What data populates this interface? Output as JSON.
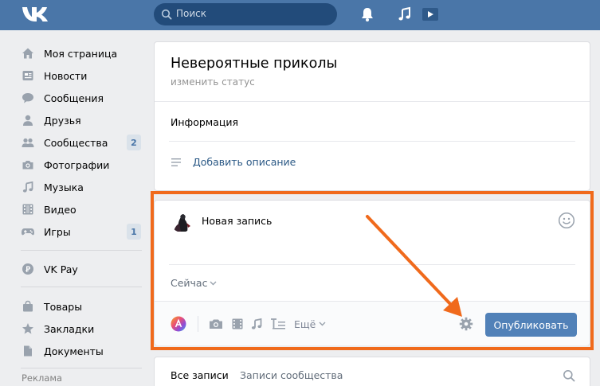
{
  "header": {
    "search_placeholder": "Поиск",
    "icons": [
      "vk-logo",
      "search-icon",
      "bell-icon",
      "music-icon",
      "play-icon"
    ],
    "bg_color": "#4a76a8"
  },
  "sidebar": {
    "items": [
      {
        "label": "Моя страница",
        "icon": "home-icon"
      },
      {
        "label": "Новости",
        "icon": "news-icon"
      },
      {
        "label": "Сообщения",
        "icon": "messages-icon"
      },
      {
        "label": "Друзья",
        "icon": "friends-icon"
      },
      {
        "label": "Сообщества",
        "icon": "communities-icon",
        "badge": "2"
      },
      {
        "label": "Фотографии",
        "icon": "photos-icon"
      },
      {
        "label": "Музыка",
        "icon": "music-icon"
      },
      {
        "label": "Видео",
        "icon": "video-icon"
      },
      {
        "label": "Игры",
        "icon": "games-icon",
        "badge": "1"
      },
      {
        "label": "VK Pay",
        "icon": "vkpay-icon"
      },
      {
        "label": "Товары",
        "icon": "market-icon"
      },
      {
        "label": "Закладки",
        "icon": "bookmarks-icon"
      },
      {
        "label": "Документы",
        "icon": "documents-icon"
      }
    ],
    "ads_label": "Реклама"
  },
  "profile": {
    "name": "Невероятные приколы",
    "status_link": "изменить статус",
    "info_label": "Информация",
    "add_description": "Добавить описание"
  },
  "post": {
    "placeholder": "Новая запись",
    "time": "Сейчас",
    "more": "Ещё",
    "publish": "Опубликовать",
    "highlight_color": "#f06a1c"
  },
  "wall_tabs": {
    "all": "Все записи",
    "community": "Записи сообщества"
  }
}
